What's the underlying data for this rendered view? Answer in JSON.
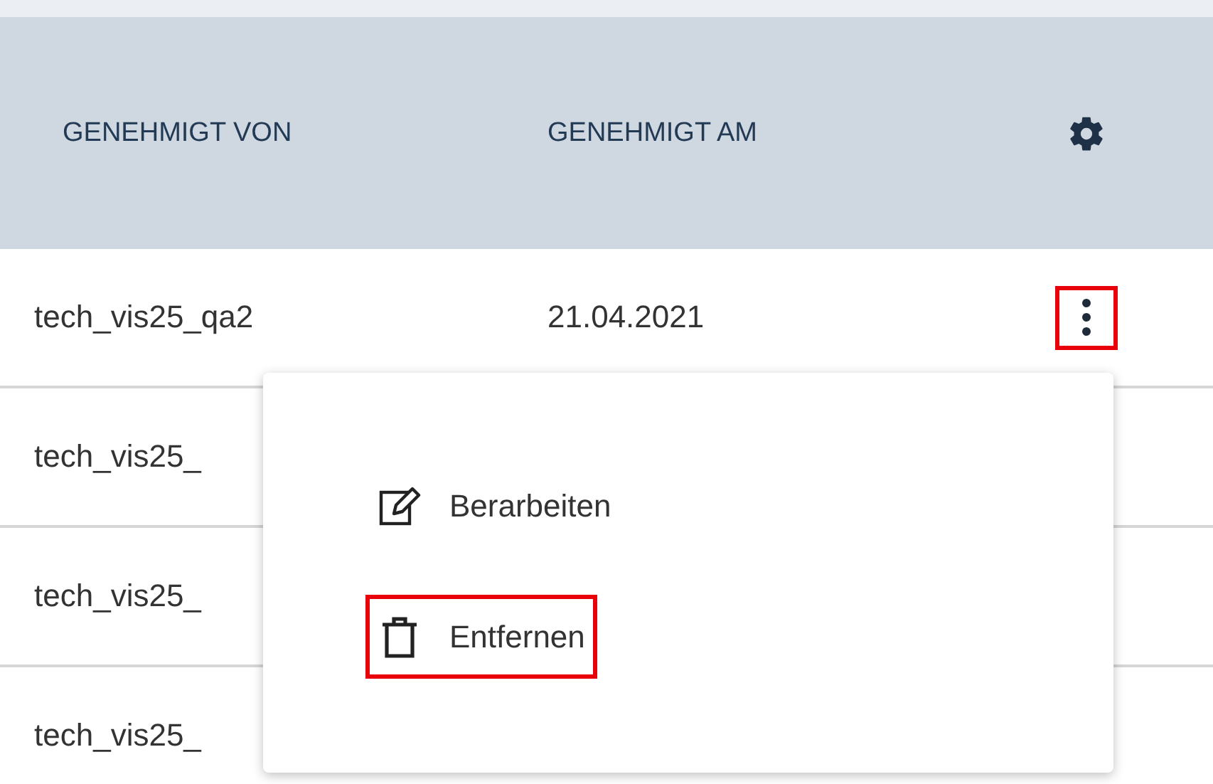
{
  "table": {
    "columns": [
      {
        "label": "GENEHMIGT VON"
      },
      {
        "label": "GENEHMIGT AM"
      }
    ],
    "rows": [
      {
        "approved_by": "tech_vis25_qa2",
        "approved_on": "21.04.2021",
        "menu_button": {
          "highlighted": true
        }
      },
      {
        "approved_by": "tech_vis25_"
      },
      {
        "approved_by": "tech_vis25_"
      },
      {
        "approved_by": "tech_vis25_"
      }
    ]
  },
  "context_menu": {
    "items": [
      {
        "kind": "edit",
        "label": "Berarbeiten",
        "highlighted": false
      },
      {
        "kind": "delete",
        "label": "Entfernen",
        "highlighted": true
      }
    ]
  }
}
